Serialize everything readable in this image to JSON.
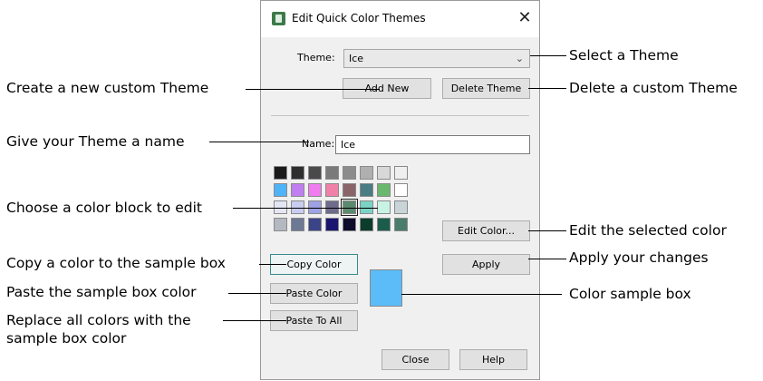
{
  "dialog": {
    "title": "Edit Quick Color Themes",
    "close_glyph": "✕",
    "theme_label": "Theme:",
    "theme_value": "Ice",
    "add_new": "Add New",
    "delete_theme": "Delete Theme",
    "name_label": "Name:",
    "name_value": "Ice",
    "edit_color": "Edit Color...",
    "apply": "Apply",
    "copy_color": "Copy Color",
    "paste_color": "Paste Color",
    "paste_to_all": "Paste To All",
    "close": "Close",
    "help": "Help",
    "sample_color": "#5bbcf8",
    "swatch_rows": [
      [
        "#1a1a1a",
        "#2e2e2e",
        "#4a4a4a",
        "#7a7a7a",
        "#8c8c8c",
        "#b0b0b0",
        "#d8d8d8",
        "#efefef"
      ],
      [
        "#4fb3f7",
        "#c07ef0",
        "#f07cf0",
        "#f080a8",
        "#8a6468",
        "#4a7c84",
        "#6ab86e",
        "#ffffff"
      ],
      [
        "#e4e6f4",
        "#c8cdf0",
        "#9ea2e4",
        "#6e6c8c",
        "#5b8a6e",
        "#7ad4c4",
        "#c8f2e4",
        "#c8d4d8"
      ],
      [
        "#b4b8c0",
        "#6c7894",
        "#3c4488",
        "#1a1670",
        "#0c0c2c",
        "#0c3c2c",
        "#1c5c4c",
        "#4a7c6c"
      ]
    ],
    "selected_swatch": "row 3, column 5"
  },
  "annotations": {
    "select_theme": "Select a Theme",
    "create_theme": "Create a new custom Theme",
    "delete_theme": "Delete a custom Theme",
    "give_name": "Give your Theme a name",
    "choose_block": "Choose a color block to edit",
    "edit_selected": "Edit the selected color",
    "copy_to_sample": "Copy a color to the sample box",
    "apply_changes": "Apply your changes",
    "paste_sample": "Paste the sample box color",
    "color_sample_box": "Color sample box",
    "replace_all_1": "Replace all colors with the",
    "replace_all_2": "sample box color"
  }
}
